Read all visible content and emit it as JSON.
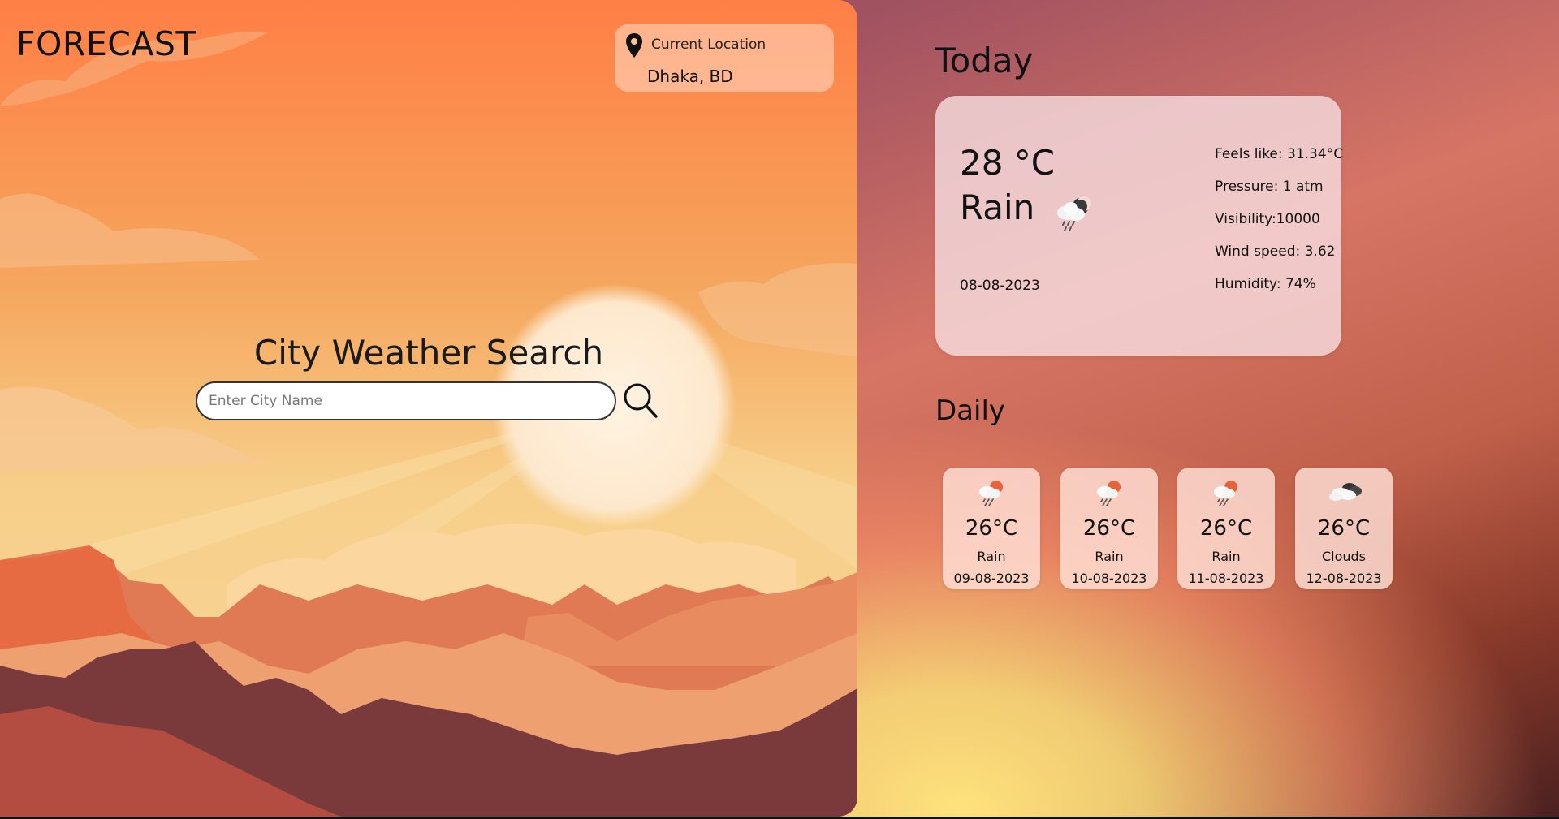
{
  "app": {
    "brand": "FORECAST"
  },
  "location": {
    "label": "Current Location",
    "value": "Dhaka, BD",
    "icon": "map-pin-icon"
  },
  "search": {
    "title": "City Weather Search",
    "placeholder": "Enter City Name",
    "value": "",
    "icon": "search-icon"
  },
  "today": {
    "heading": "Today",
    "temperature": "28 °C",
    "condition": "Rain",
    "icon": "cloud-rain-night-icon",
    "date": "08-08-2023",
    "details": {
      "feels_like": "Feels like: 31.34°C",
      "pressure": "Pressure: 1 atm",
      "visibility": "Visibility:10000",
      "wind_speed": "Wind speed: 3.62",
      "humidity": "Humidity: 74%"
    }
  },
  "daily": {
    "heading": "Daily",
    "days": [
      {
        "temp": "26°C",
        "condition": "Rain",
        "date": "09-08-2023",
        "icon": "cloud-rain-sun-icon"
      },
      {
        "temp": "26°C",
        "condition": "Rain",
        "date": "10-08-2023",
        "icon": "cloud-rain-sun-icon"
      },
      {
        "temp": "26°C",
        "condition": "Rain",
        "date": "11-08-2023",
        "icon": "cloud-rain-sun-icon"
      },
      {
        "temp": "26°C",
        "condition": "Clouds",
        "date": "12-08-2023",
        "icon": "clouds-icon"
      }
    ]
  },
  "colors": {
    "accent_sun": "#e8623a",
    "card_bg": "#f5dcde",
    "text": "#111111"
  }
}
